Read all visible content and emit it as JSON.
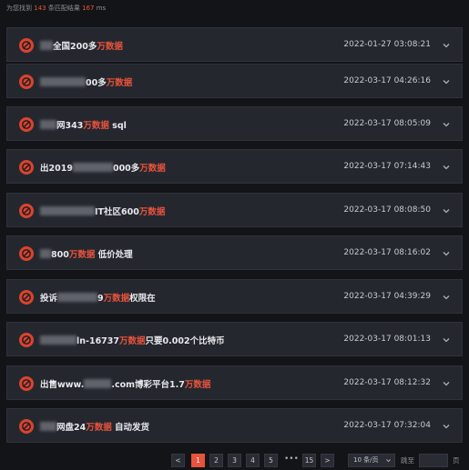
{
  "stats": {
    "prefix": "为您找到",
    "count": "143",
    "middle": "条匹配结果",
    "time": "167",
    "unit": "ms"
  },
  "results": [
    {
      "redacted": true,
      "parts": [
        "全国200多",
        "万数据"
      ],
      "suffix": "",
      "date": "2022-01-27 03:08:21"
    },
    {
      "redacted": true,
      "parts": [
        "00多",
        "万数据"
      ],
      "suffix": "",
      "date": "2022-03-17 04:26:16"
    },
    {
      "redacted": true,
      "parts": [
        "网343",
        "万数据"
      ],
      "suffix": " sql",
      "date": "2022-03-17 08:05:09"
    },
    {
      "redacted": true,
      "lead": "出2019",
      "parts": [
        "000多",
        "万数据"
      ],
      "suffix": "",
      "date": "2022-03-17 07:14:43"
    },
    {
      "redacted": true,
      "parts": [
        "IT社区600",
        "万数据"
      ],
      "suffix": "",
      "date": "2022-03-17 08:08:50"
    },
    {
      "redacted": true,
      "parts": [
        "800",
        "万数据"
      ],
      "suffix": " 低价处理",
      "date": "2022-03-17 08:16:02"
    },
    {
      "redacted": true,
      "lead": "投诉",
      "parts": [
        "9",
        "万数据"
      ],
      "suffix": "权限在",
      "date": "2022-03-17 04:39:29"
    },
    {
      "redacted": true,
      "parts": [
        "ln-16737",
        "万数据"
      ],
      "suffix": "只要0.002个比特币",
      "date": "2022-03-17 08:01:13"
    },
    {
      "redacted": true,
      "lead": "出售www.",
      "parts": [
        ".com博彩平台1.7",
        "万数据"
      ],
      "suffix": "",
      "date": "2022-03-17 08:12:32"
    },
    {
      "redacted": true,
      "parts": [
        "网盘24",
        "万数据"
      ],
      "suffix": " 自动发货",
      "date": "2022-03-17 07:32:04"
    }
  ],
  "pagination": {
    "prev": "<",
    "next": ">",
    "pages": [
      "1",
      "2",
      "3",
      "4",
      "5"
    ],
    "ellipsis": "•••",
    "last": "15",
    "current": "1",
    "page_size": "10 条/页",
    "jump_label": "跳至",
    "jump_value": "",
    "page_label": "页"
  },
  "colors": {
    "accent": "#e8533c",
    "row_bg": "#25272f",
    "page_bg": "#131418"
  }
}
